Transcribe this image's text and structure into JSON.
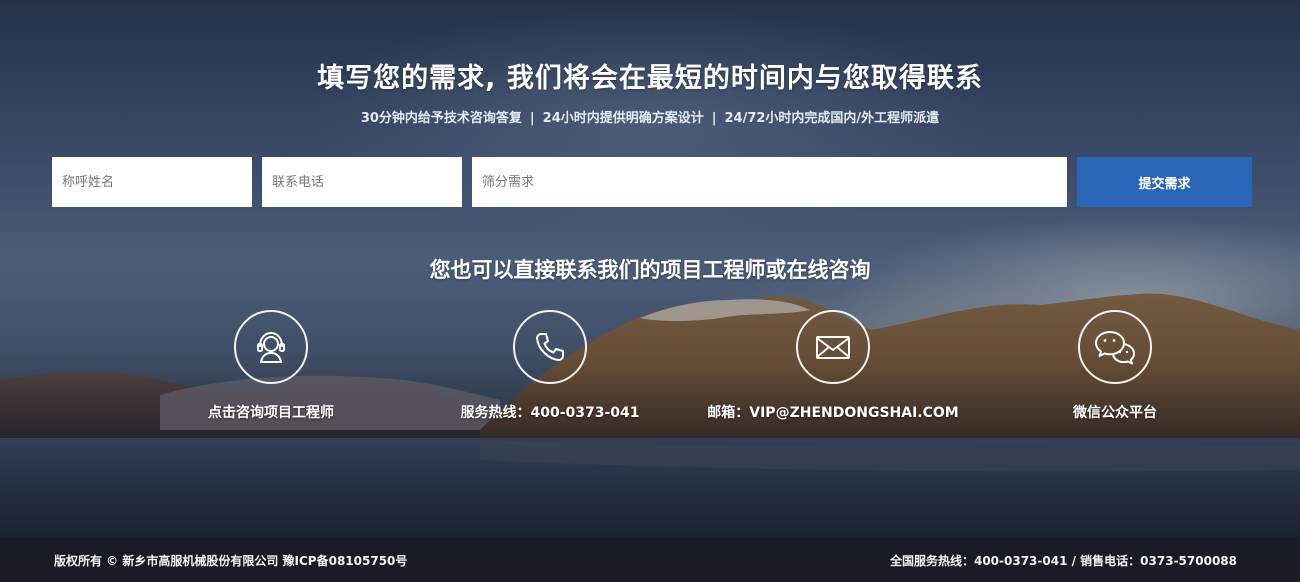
{
  "header": {
    "title": "填写您的需求, 我们将会在最短的时间内与您取得联系",
    "subtitle_items": [
      "30分钟内给予技术咨询答复",
      "24小时内提供明确方案设计",
      "24/72小时内完成国内/外工程师派遣"
    ],
    "separator": "|"
  },
  "form": {
    "name_placeholder": "称呼姓名",
    "phone_placeholder": "联系电话",
    "need_placeholder": "筛分需求",
    "name_value": "",
    "phone_value": "",
    "need_value": "",
    "submit_label": "提交需求"
  },
  "contact": {
    "heading": "您也可以直接联系我们的项目工程师或在线咨询",
    "items": [
      {
        "icon": "headset-icon",
        "label": "点击咨询项目工程师"
      },
      {
        "icon": "phone-icon",
        "label": "服务热线：400-0373-041"
      },
      {
        "icon": "envelope-icon",
        "label": "邮箱：VIP@ZHENDONGSHAI.COM"
      },
      {
        "icon": "wechat-icon",
        "label": "微信公众平台"
      }
    ]
  },
  "footer": {
    "copyright": "版权所有 © 新乡市高服机械股份有限公司 豫ICP备08105750号",
    "hotline": "全国服务热线：400-0373-041 / 销售电话：0373-5700088"
  },
  "colors": {
    "accent": "#2966b8",
    "footer_bg": "#1c1f26"
  }
}
